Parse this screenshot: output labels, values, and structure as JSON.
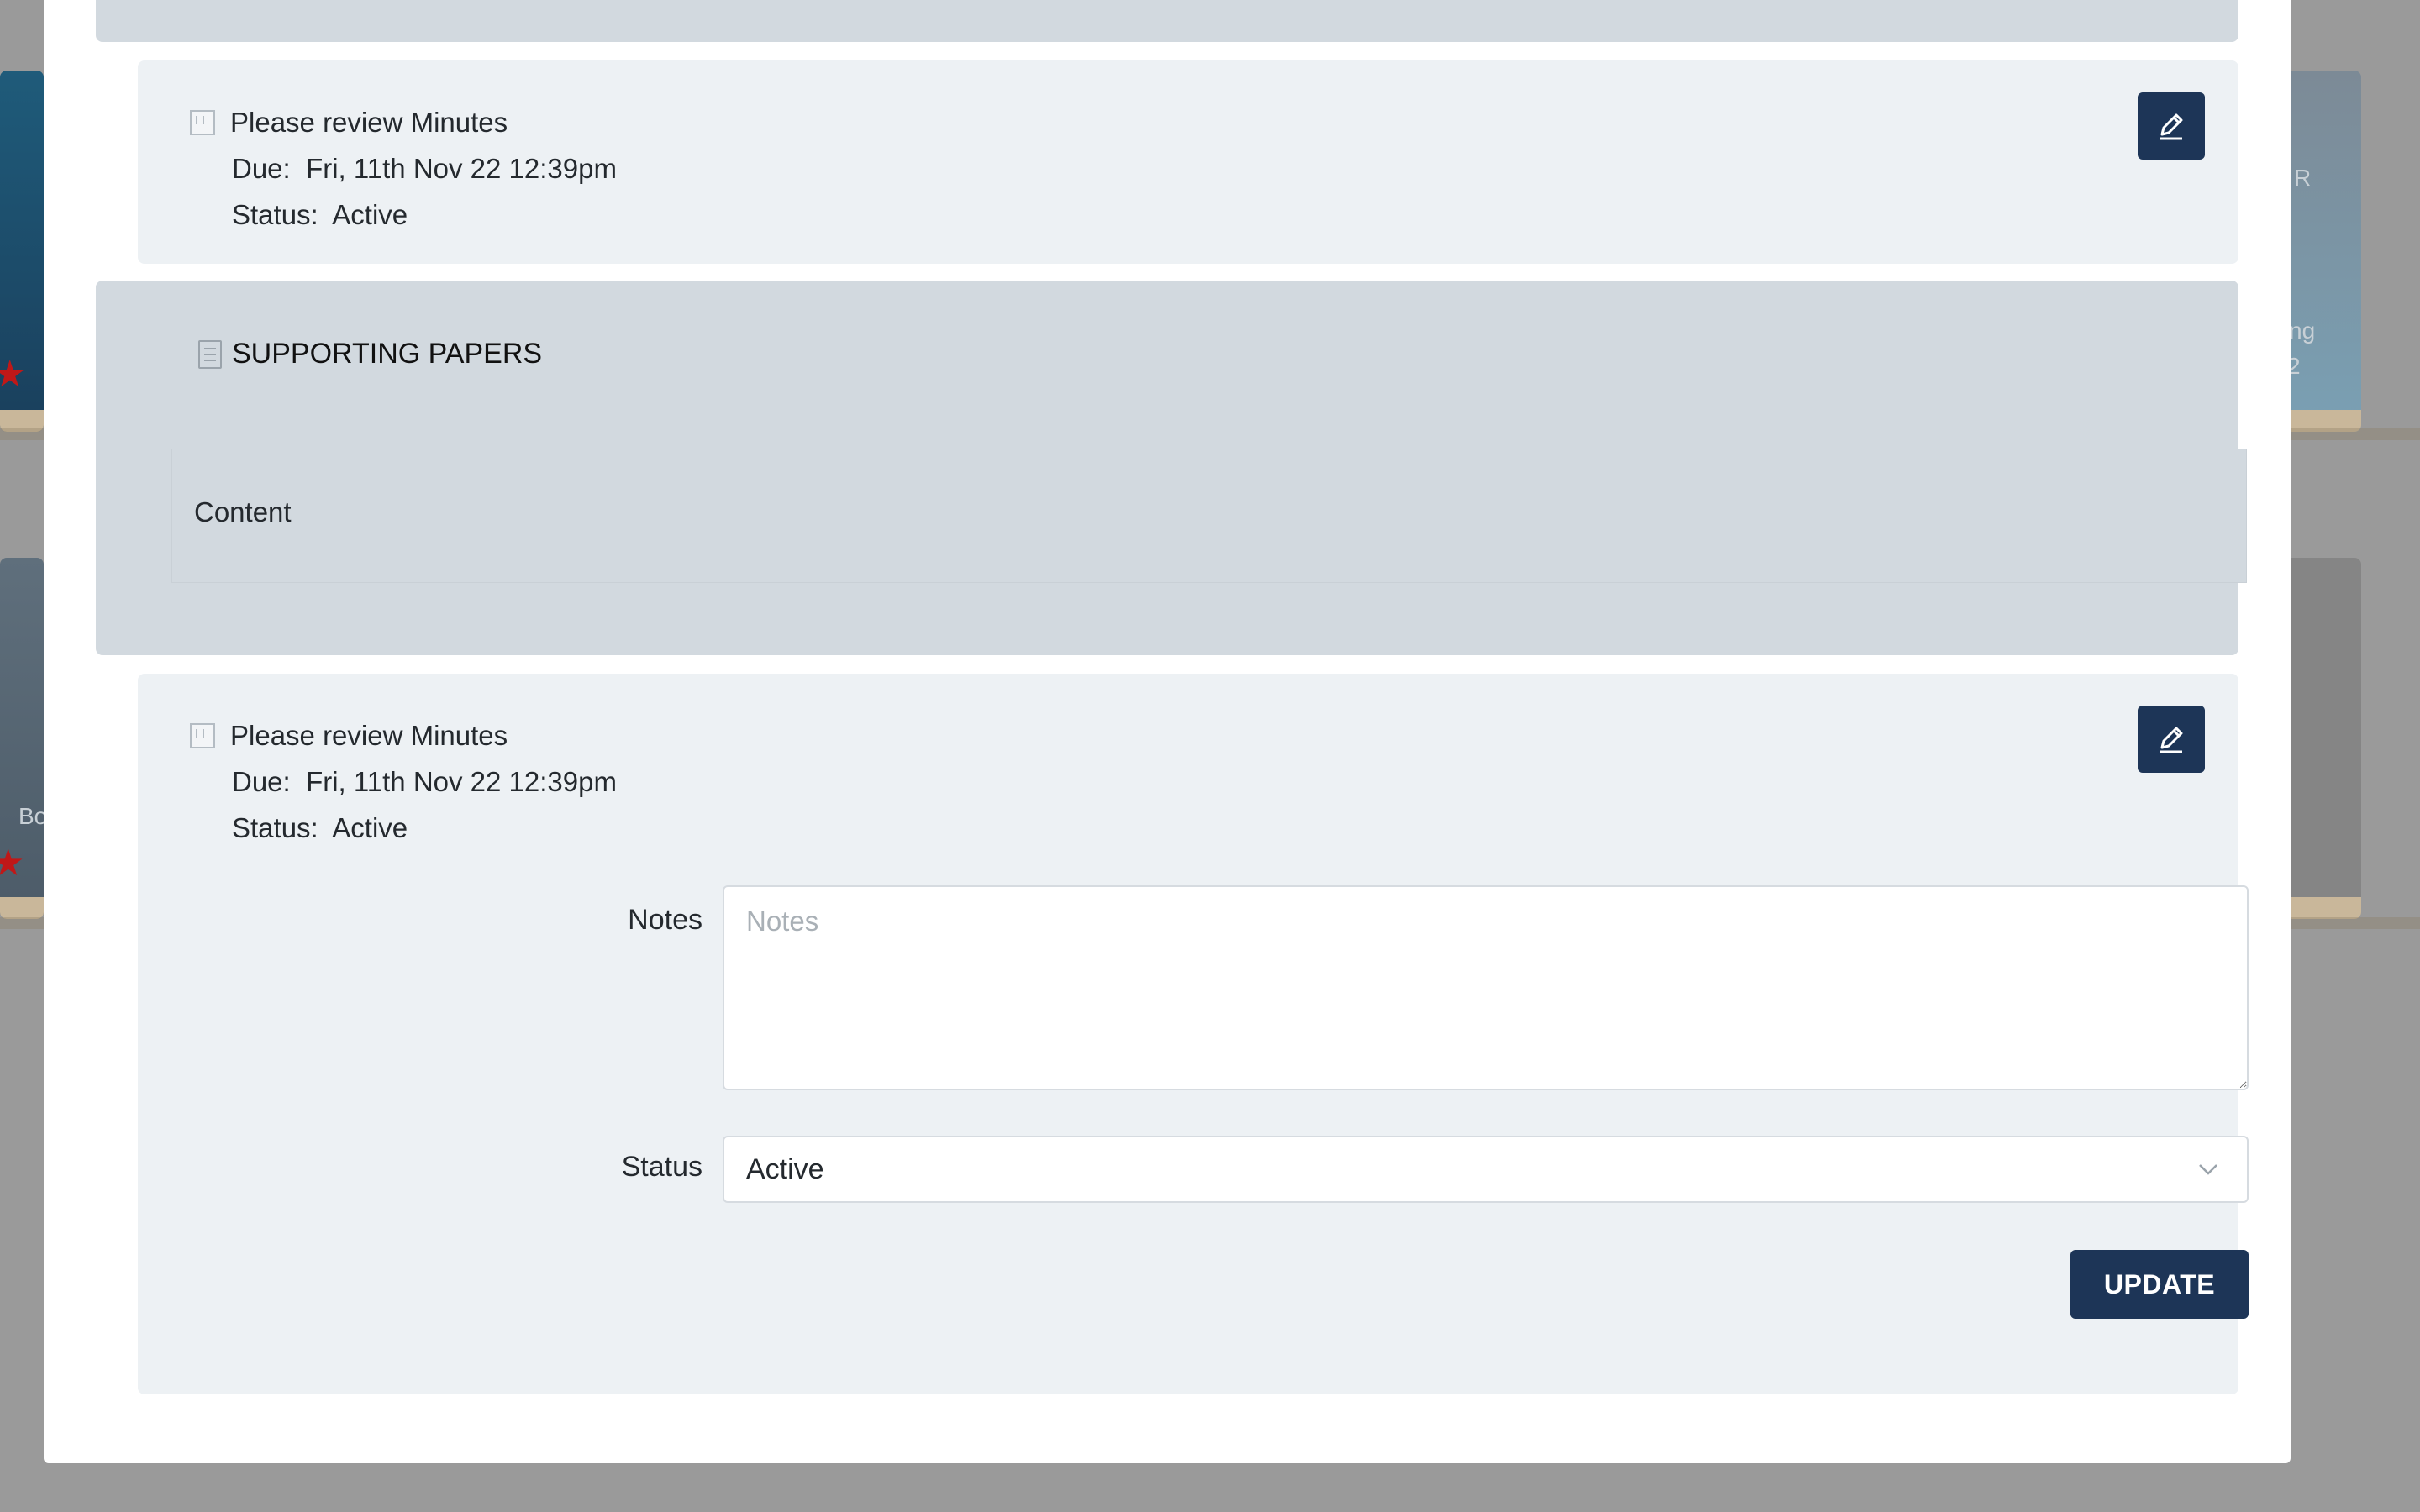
{
  "background": {
    "left_label": "Bo",
    "right_label_top": "R",
    "right_label_mid": "ting",
    "right_label_num": "2"
  },
  "tasks": [
    {
      "title": "Please review Minutes",
      "due_label": "Due:",
      "due_value": "Fri, 11th Nov 22 12:39pm",
      "status_label": "Status:",
      "status_value": "Active"
    },
    {
      "title": "Please review Minutes",
      "due_label": "Due:",
      "due_value": "Fri, 11th Nov 22 12:39pm",
      "status_label": "Status:",
      "status_value": "Active"
    }
  ],
  "supporting": {
    "heading": "SUPPORTING PAPERS",
    "content_text": "Content"
  },
  "form": {
    "notes_label": "Notes",
    "notes_placeholder": "Notes",
    "notes_value": "",
    "status_label": "Status",
    "status_value": "Active",
    "update_label": "UPDATE"
  },
  "colors": {
    "primary": "#1d3557",
    "panel": "#edf1f4",
    "band": "#d2d9df"
  },
  "icons": {
    "task": "checkbox-icon",
    "edit": "pencil-icon",
    "papers": "document-icon",
    "dropdown": "chevron-down-icon"
  }
}
